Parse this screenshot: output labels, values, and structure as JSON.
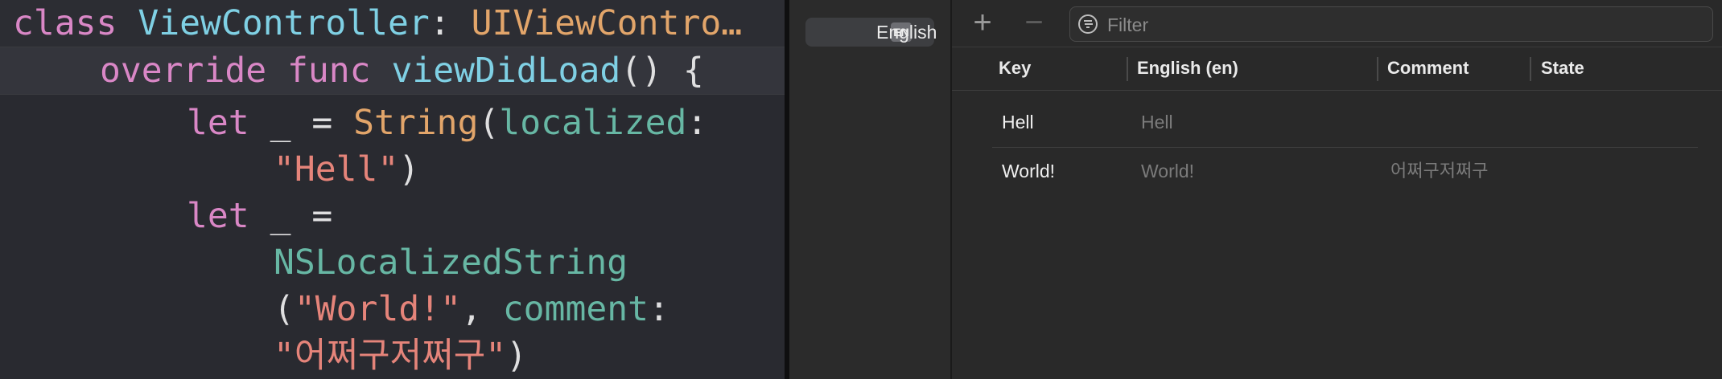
{
  "editor": {
    "sticky1": {
      "class_kw": "class",
      "class_name": "ViewController",
      "colon": ":",
      "super": "UIViewContro…"
    },
    "sticky2": {
      "override": "override",
      "func": "func",
      "name": "viewDidLoad",
      "parens": "()",
      "brace": "{"
    },
    "line1": {
      "let": "let",
      "underscore": "_",
      "eq": "=",
      "type": "String",
      "paren": "(",
      "label": "localized",
      "colon": ":"
    },
    "line2": {
      "str": "\"Hell\"",
      "close": ")"
    },
    "line3": {
      "let": "let",
      "underscore": "_",
      "eq": "="
    },
    "line4": {
      "fn": "NSLocalizedString"
    },
    "line5": {
      "open": "(",
      "str": "\"World!\"",
      "comma": ",",
      "label": "comment",
      "colon": ":"
    },
    "line6": {
      "str": "\"어쩌구저쩌구\"",
      "close": ")"
    }
  },
  "languages": [
    {
      "code": "EN",
      "label": "English"
    }
  ],
  "toolbar": {
    "add_symbol": "+",
    "remove_symbol": "−",
    "filter_placeholder": "Filter"
  },
  "table": {
    "columns": [
      "Key",
      "English (en)",
      "Comment",
      "State"
    ],
    "rows": [
      {
        "key": "Hell",
        "value": "Hell",
        "comment": ""
      },
      {
        "key": "World!",
        "value": "World!",
        "comment": "어쩌구저쩌구"
      }
    ]
  }
}
